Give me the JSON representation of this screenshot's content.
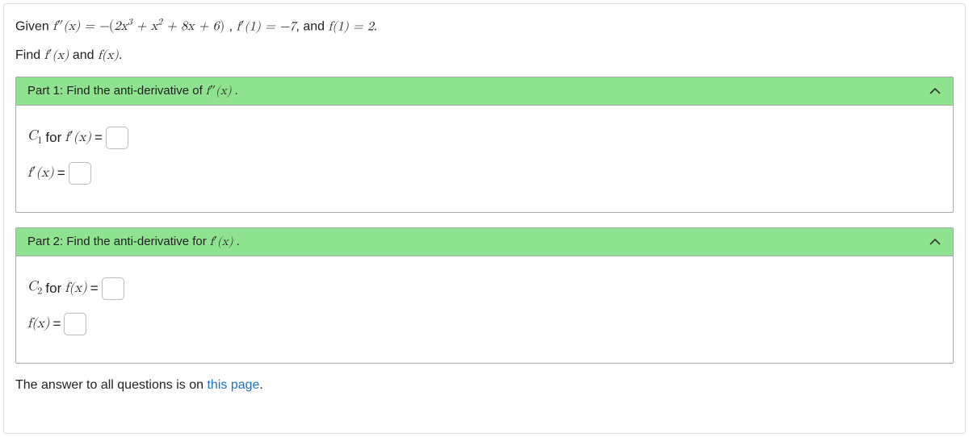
{
  "given": {
    "prefix": "Given ",
    "eq_lhs": "f″(x) = −",
    "eq_paren": "(2x³ + x² + 8x + 6)",
    "sep1": ", ",
    "cond1": "f′(1) = −7",
    "sep2": ", and ",
    "cond2": "f(1) = 2",
    "suffix": "."
  },
  "find": {
    "prefix": "Find ",
    "a": "f′(x)",
    "and": " and ",
    "b": "f(x)",
    "suffix": "."
  },
  "part1": {
    "header_prefix": "Part 1: Find the anti-derivative of ",
    "header_fn": "f″(x)",
    "header_suffix": ".",
    "c_label_pre": "C",
    "c_sub": "1",
    "c_label_post": " for ",
    "c_fn": "f′(x)",
    "eq": " = ",
    "fprime": "f′(x)",
    "c1_value": "",
    "fprime_value": ""
  },
  "part2": {
    "header_prefix": "Part 2: Find the anti-derivative for ",
    "header_fn": "f′(x)",
    "header_suffix": ".",
    "c_label_pre": "C",
    "c_sub": "2",
    "c_label_post": " for ",
    "c_fn": "f(x)",
    "eq": " = ",
    "f": "f(x)",
    "c2_value": "",
    "f_value": ""
  },
  "footer": {
    "text": "The answer to all questions is on ",
    "link": "this page",
    "suffix": "."
  }
}
